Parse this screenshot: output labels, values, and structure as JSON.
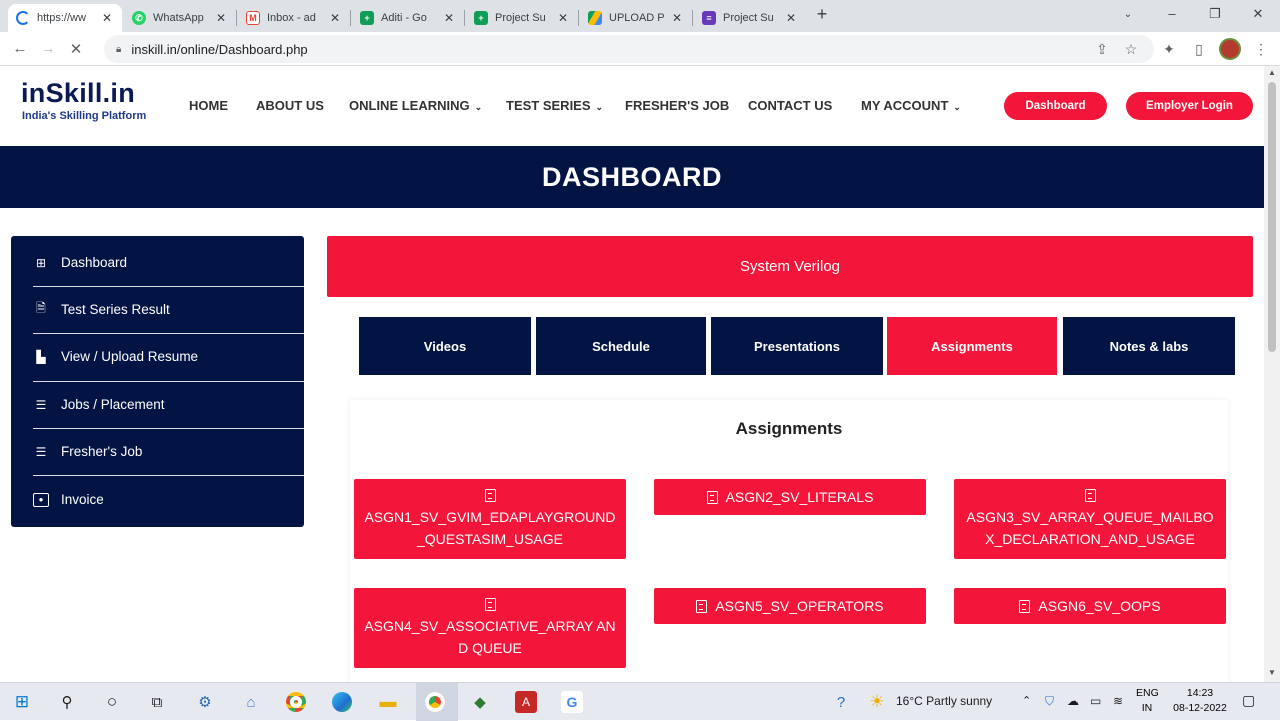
{
  "browser": {
    "tabs": [
      {
        "label": "https://ww",
        "icon": "chrome-loading-icon",
        "color": "#1a73e8",
        "active": true
      },
      {
        "label": "WhatsApp",
        "icon": "whatsapp-icon",
        "color": "#25d366"
      },
      {
        "label": "Inbox - ad",
        "icon": "gmail-icon",
        "color": "#ea4335"
      },
      {
        "label": "Aditi - Go",
        "icon": "sheets-icon",
        "color": "#0f9d58"
      },
      {
        "label": "Project Su",
        "icon": "sheets-icon",
        "color": "#0f9d58"
      },
      {
        "label": "UPLOAD P",
        "icon": "drive-icon",
        "color": "#fbbc04"
      },
      {
        "label": "Project Su",
        "icon": "forms-icon",
        "color": "#673ab7"
      }
    ],
    "close_glyph": "✕",
    "new_tab_glyph": "+",
    "url": "inskill.in/online/Dashboard.php"
  },
  "site": {
    "logo_name": "inSkill.in",
    "logo_tagline": "India's Skilling Platform",
    "menu": [
      {
        "label": "HOME",
        "dropdown": false
      },
      {
        "label": "ABOUT US",
        "dropdown": false
      },
      {
        "label": "ONLINE LEARNING",
        "dropdown": true
      },
      {
        "label": "TEST SERIES",
        "dropdown": true
      },
      {
        "label": "FRESHER'S JOB",
        "dropdown": false
      },
      {
        "label": "CONTACT US",
        "dropdown": false
      },
      {
        "label": "MY ACCOUNT",
        "dropdown": true
      }
    ],
    "dashboard_button": "Dashboard",
    "employer_button": "Employer Login",
    "accent_color": "#f4153a",
    "navy_color": "#021444"
  },
  "banner": {
    "title": "DASHBOARD"
  },
  "sidebar": {
    "items": [
      {
        "label": "Dashboard",
        "icon": "grid-icon"
      },
      {
        "label": "Test Series Result",
        "icon": "document-icon"
      },
      {
        "label": "View / Upload Resume",
        "icon": "file-icon"
      },
      {
        "label": "Jobs / Placement",
        "icon": "list-icon"
      },
      {
        "label": "Fresher's Job",
        "icon": "list-icon"
      },
      {
        "label": "Invoice",
        "icon": "money-icon"
      }
    ]
  },
  "course": {
    "title": "System Verilog",
    "tabs": [
      {
        "label": "Videos",
        "active": false
      },
      {
        "label": "Schedule",
        "active": false
      },
      {
        "label": "Presentations",
        "active": false
      },
      {
        "label": "Assignments",
        "active": true
      },
      {
        "label": "Notes & labs",
        "active": false
      }
    ],
    "section_title": "Assignments",
    "assignments": [
      "ASGN1_SV_GVIM_EDAPLAYGROUND_QUESTASIM_USAGE",
      "ASGN2_SV_LITERALS",
      "ASGN3_SV_ARRAY_QUEUE_MAILBOX_DECLARATION_AND_USAGE",
      "ASGN4_SV_ASSOCIATIVE_ARRAY AND QUEUE",
      "ASGN5_SV_OPERATORS",
      "ASGN6_SV_OOPS"
    ]
  },
  "taskbar": {
    "weather": "16°C  Partly sunny",
    "lang_top": "ENG",
    "lang_bottom": "IN",
    "time": "14:23",
    "date": "08-12-2022"
  }
}
